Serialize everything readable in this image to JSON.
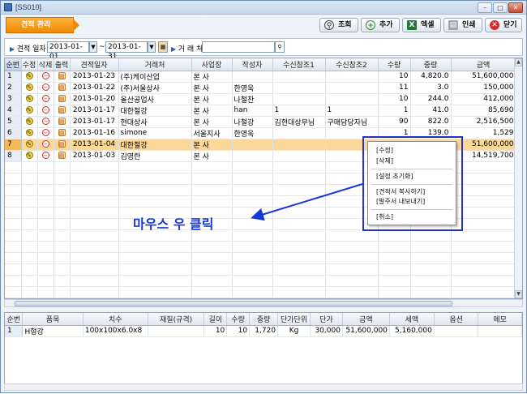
{
  "window": {
    "title": "[SS010]"
  },
  "page_title": "견적 관리",
  "toolbar": {
    "search": "조회",
    "add": "추가",
    "excel": "엑셀",
    "print": "인쇄",
    "close": "닫기"
  },
  "filter": {
    "date_label": "견적 일자",
    "date_from": "2013-01-01",
    "date_sep": "~",
    "date_to": "2013-01-31",
    "client_label": "거 래 처",
    "client_value": ""
  },
  "grid": {
    "headers": [
      "순번",
      "수정",
      "삭제",
      "출력",
      "견적일자",
      "거래처",
      "사업장",
      "작성자",
      "수신참조1",
      "수신참조2",
      "수량",
      "중량",
      "금액"
    ],
    "rows": [
      [
        "1",
        "2013-01-23",
        "(주)케이산업",
        "본   사",
        "",
        "",
        "",
        "10",
        "4,820.0",
        "51,600,000"
      ],
      [
        "2",
        "2013-01-22",
        "(주)서울상사",
        "본   사",
        "한영욱",
        "",
        "",
        "11",
        "3.0",
        "150,000"
      ],
      [
        "3",
        "2013-01-20",
        "올산공업사",
        "본   사",
        "나철찬",
        "",
        "",
        "10",
        "244.0",
        "412,000"
      ],
      [
        "4",
        "2013-01-17",
        "대한철강",
        "본   사",
        "han",
        "1",
        "1",
        "1",
        "41.0",
        "85,690"
      ],
      [
        "5",
        "2013-01-17",
        "현대상사",
        "본   사",
        "나철강",
        "김현대상무님",
        "구매담당자님",
        "90",
        "822.0",
        "2,516,500"
      ],
      [
        "6",
        "2013-01-16",
        "simone",
        "서울지사",
        "한영욱",
        "",
        "",
        "1",
        "139.0",
        "1,529"
      ],
      [
        "7",
        "2013-01-04",
        "대한철강",
        "본   사",
        "",
        "",
        "",
        "",
        "",
        "51,600,000"
      ],
      [
        "8",
        "2013-01-03",
        "김영란",
        "본   사",
        "",
        "",
        "",
        "",
        "",
        "14,519,700"
      ]
    ],
    "selected_index": 6
  },
  "detail": {
    "headers": [
      "순번",
      "품목",
      "치수",
      "재질(규격)",
      "길이",
      "수량",
      "중량",
      "단가단위",
      "단가",
      "금액",
      "세액",
      "옵션",
      "메모"
    ],
    "rows": [
      [
        "1",
        "H형강",
        "100x100x6.0x8",
        "",
        "10",
        "10",
        "1,720",
        "Kg",
        "30,000",
        "51,600,000",
        "5,160,000",
        "",
        ""
      ]
    ]
  },
  "context_menu": {
    "items": [
      "[수정]",
      "[삭제]",
      "[설정 초기화]",
      "[견적서 복사하기]",
      "[발주서 내보내기]",
      "[취소]"
    ]
  },
  "annotation": {
    "text": "마우스 우 클릭"
  },
  "colors": {
    "selected_row": "#fcd79a",
    "title_orange": "#f08a00",
    "annotation_blue": "#1838d8"
  }
}
